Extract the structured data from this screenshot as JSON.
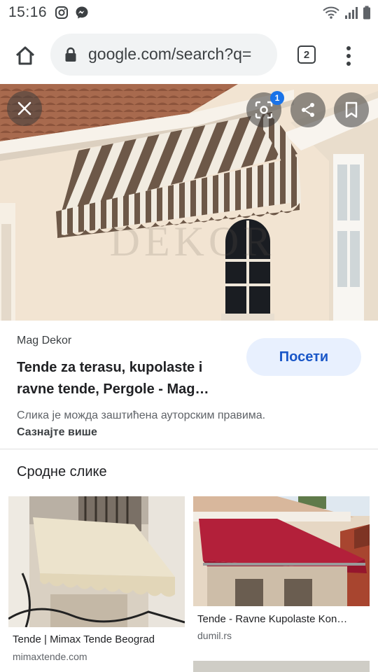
{
  "status_bar": {
    "time": "15:16"
  },
  "browser": {
    "url": "google.com/search?q=",
    "tab_count": "2"
  },
  "image_viewer": {
    "badge_count": "1",
    "watermark": "DEKOR",
    "source": "Mag Dekor",
    "visit_label": "Посети",
    "title": "Tende za terasu, kupolaste i ravne tende, Pergole - Mag…",
    "copyright_text": "Слика је можда заштићена ауторским правима.",
    "learn_more": "Сазнајте више"
  },
  "related": {
    "heading": "Сродне слике",
    "items": [
      {
        "title": "Tende | Mimax Tende Beograd",
        "domain": "mimaxtende.com"
      },
      {
        "title": "Tende - Ravne Kupolaste Kon…",
        "domain": "dumil.rs"
      }
    ]
  }
}
